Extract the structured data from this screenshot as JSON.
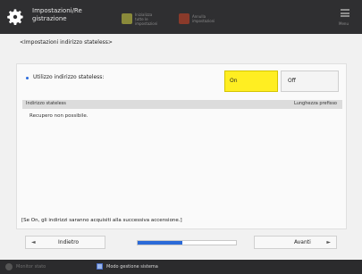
{
  "header": {
    "title": "Impostazioni/Re gistrazione",
    "buttons": [
      {
        "label": "Inizializza tutte le impostazioni",
        "icon": "document-icon",
        "color": "#c8c84a"
      },
      {
        "label": "Annulla impostazioni",
        "icon": "cancel-icon",
        "color": "#b44a2a"
      }
    ],
    "menu_label": "Menu"
  },
  "breadcrumb": "<Impostazioni indirizzo stateless>",
  "setting": {
    "label": "Utilizzo indirizzo stateless:",
    "on_label": "On",
    "off_label": "Off",
    "selected": "On"
  },
  "list": {
    "columns": [
      "Indirizzo stateless",
      "Lunghezza prefisso"
    ],
    "empty_message": "Recupero non possibile."
  },
  "note": "[Se On, gli indirizzi saranno acquisiti alla successiva accensione.]",
  "nav": {
    "back_label": "Indietro",
    "next_label": "Avanti",
    "progress": 0.45
  },
  "footer": {
    "monitor_label": "Monitor stato",
    "mode_label": "Modo gestione sistema"
  }
}
